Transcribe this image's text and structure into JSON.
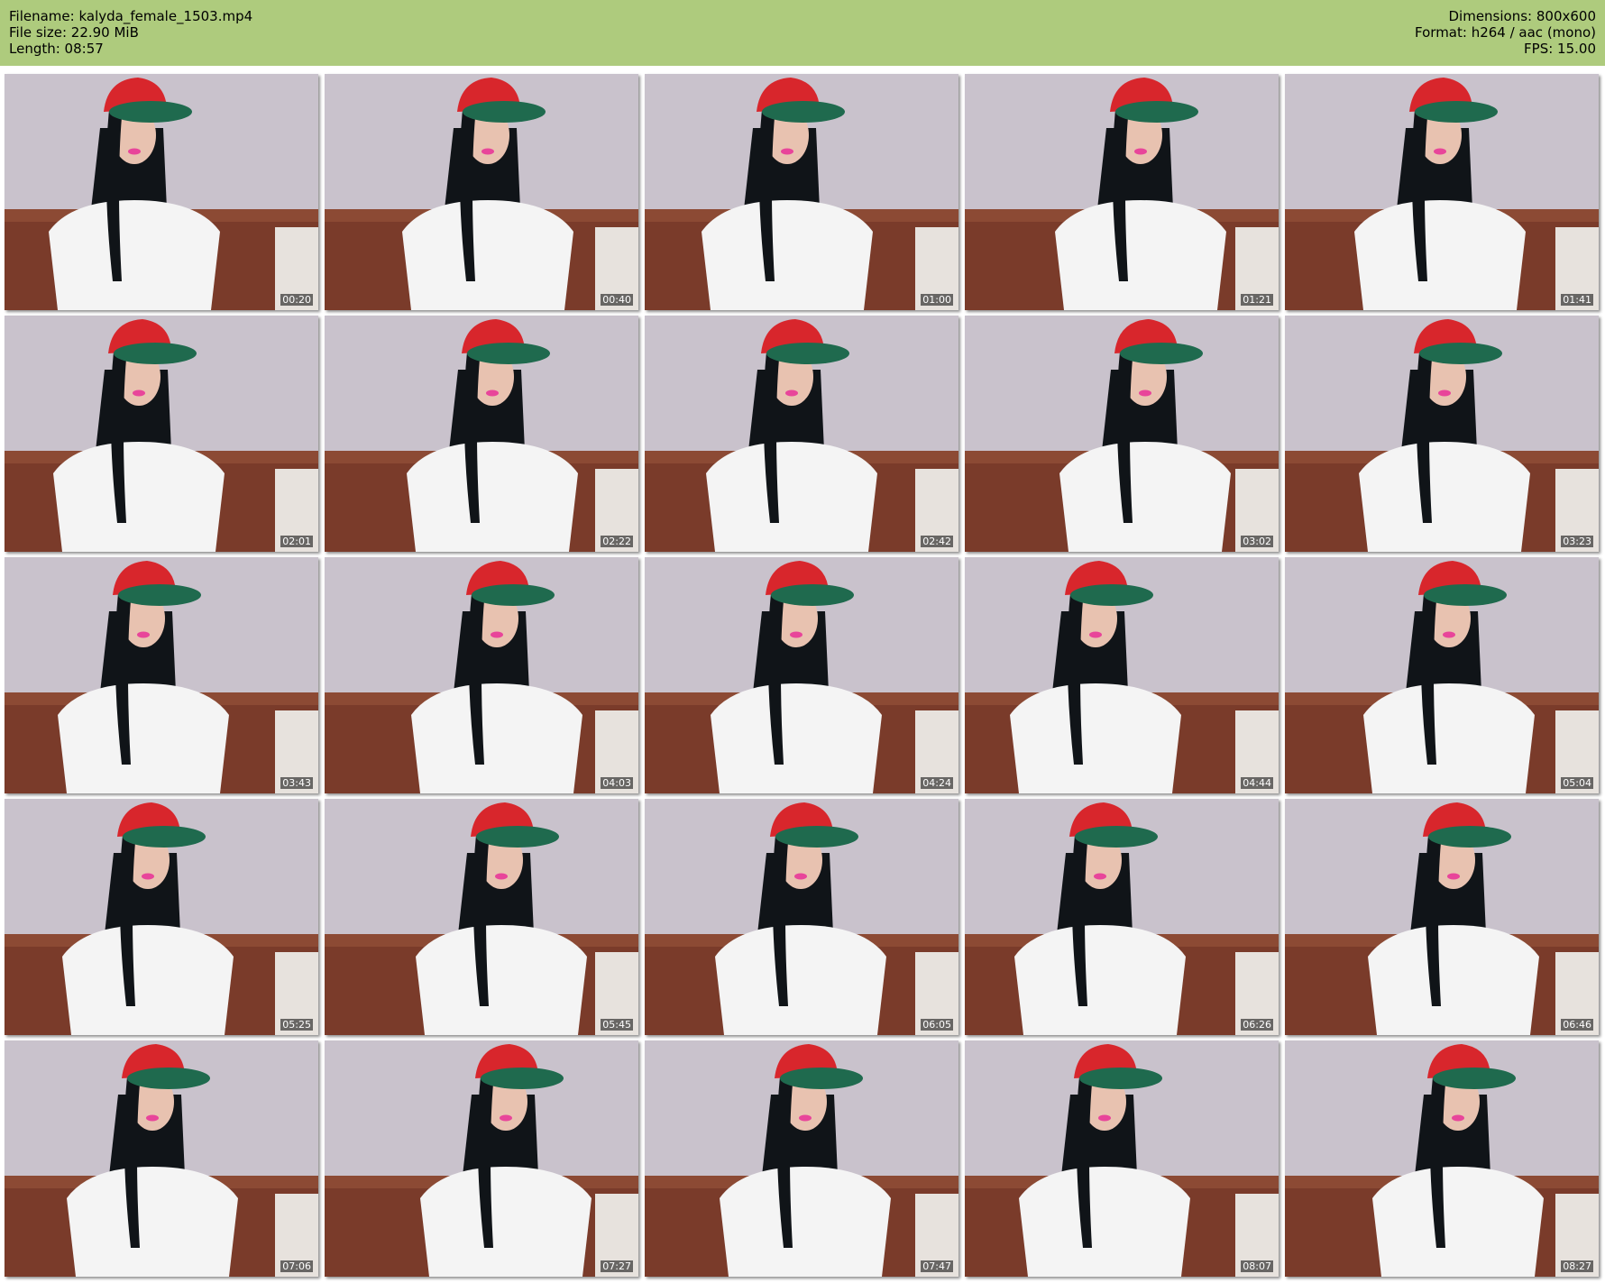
{
  "header": {
    "filename": "Filename: kalyda_female_1503.mp4",
    "filesize": "File size: 22.90 MiB",
    "length": "Length: 08:57",
    "dimensions": "Dimensions: 800x600",
    "format": "Format: h264 / aac (mono)",
    "fps": "FPS: 15.00"
  },
  "colors": {
    "header_bg": "#aecb7d",
    "wall": "#c9c2cc",
    "couch": "#7a3b2a",
    "cap_red": "#d8262c",
    "cap_green": "#1f6a4e",
    "shirt": "#f4f4f4",
    "hair": "#101418",
    "skin": "#e8c2b0"
  },
  "thumbnails": [
    {
      "timestamp": "00:20"
    },
    {
      "timestamp": "00:40"
    },
    {
      "timestamp": "01:00"
    },
    {
      "timestamp": "01:21"
    },
    {
      "timestamp": "01:41"
    },
    {
      "timestamp": "02:01"
    },
    {
      "timestamp": "02:22"
    },
    {
      "timestamp": "02:42"
    },
    {
      "timestamp": "03:02"
    },
    {
      "timestamp": "03:23"
    },
    {
      "timestamp": "03:43"
    },
    {
      "timestamp": "04:03"
    },
    {
      "timestamp": "04:24"
    },
    {
      "timestamp": "04:44"
    },
    {
      "timestamp": "05:04"
    },
    {
      "timestamp": "05:25"
    },
    {
      "timestamp": "05:45"
    },
    {
      "timestamp": "06:05"
    },
    {
      "timestamp": "06:26"
    },
    {
      "timestamp": "06:46"
    },
    {
      "timestamp": "07:06"
    },
    {
      "timestamp": "07:27"
    },
    {
      "timestamp": "07:47"
    },
    {
      "timestamp": "08:07"
    },
    {
      "timestamp": "08:27"
    }
  ]
}
